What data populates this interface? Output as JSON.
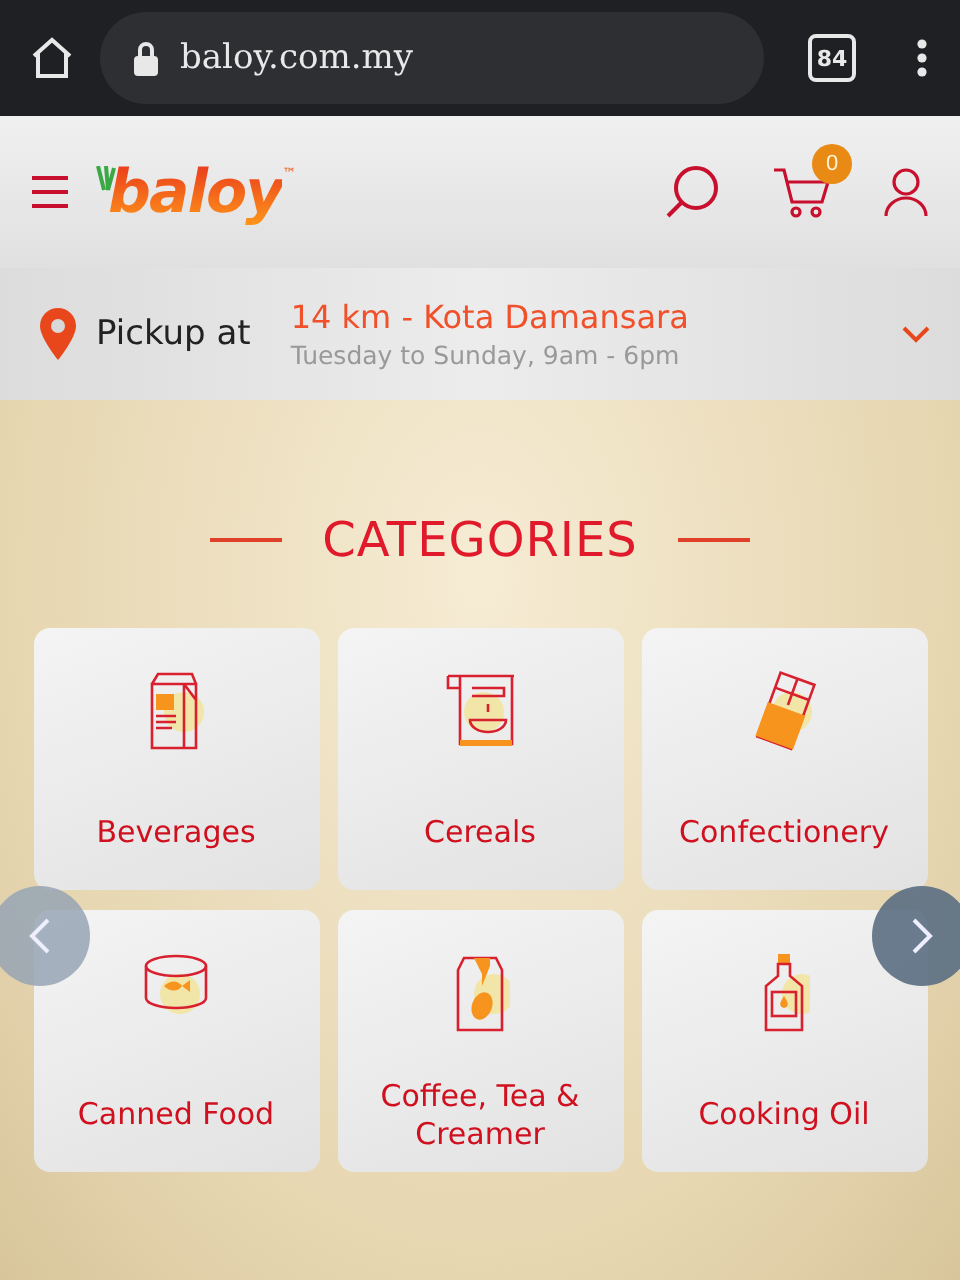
{
  "browser": {
    "url": "baloy.com.my",
    "tab_count": "84"
  },
  "header": {
    "logo": "baloy",
    "logo_mark": "™",
    "cart_count": "0"
  },
  "pickup": {
    "label": "Pickup at",
    "location": "14 km - Kota Damansara",
    "hours": "Tuesday to Sunday, 9am - 6pm"
  },
  "categories": {
    "title": "CATEGORIES",
    "items": [
      {
        "label": "Beverages"
      },
      {
        "label": "Cereals"
      },
      {
        "label": "Confectionery"
      },
      {
        "label": "Canned Food"
      },
      {
        "label": "Coffee, Tea & Creamer"
      },
      {
        "label": "Cooking Oil"
      }
    ]
  }
}
